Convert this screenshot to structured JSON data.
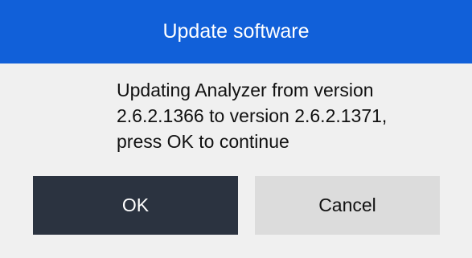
{
  "dialog": {
    "title": "Update software",
    "message_lines": [
      "Updating Analyzer from version",
      "2.6.2.1366 to version 2.6.2.1371,",
      "press OK to continue"
    ],
    "buttons": {
      "ok_label": "OK",
      "cancel_label": "Cancel"
    }
  },
  "colors": {
    "titlebar": "#1160d9",
    "ok_button": "#2b3340",
    "cancel_button": "#dcdcdc",
    "background": "#f0f0f0"
  }
}
